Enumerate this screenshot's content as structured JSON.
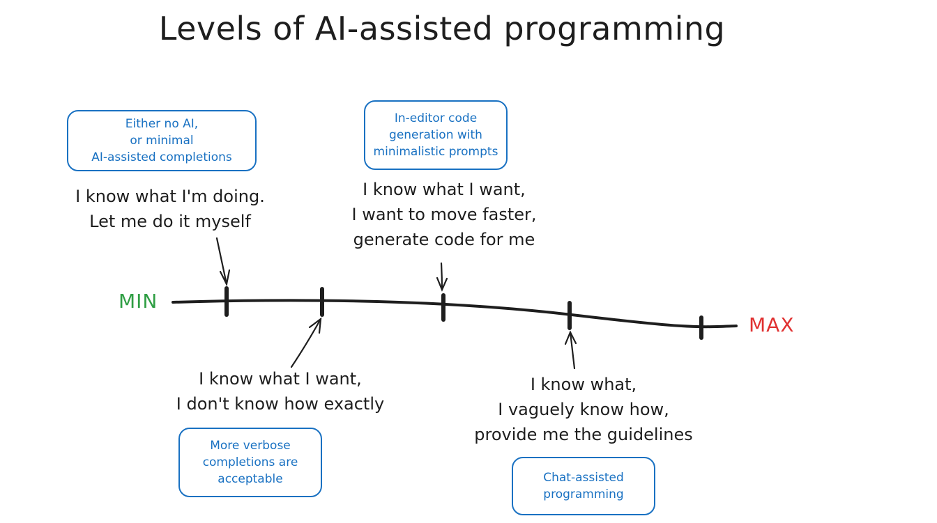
{
  "title": "Levels of AI-assisted programming",
  "scale": {
    "min_label": "MIN",
    "max_label": "MAX",
    "min_color": "#2f9e44",
    "max_color": "#e03131",
    "line_color": "#1e1e1e",
    "box_color": "#1971c2"
  },
  "levels": [
    {
      "caption": [
        "I know what I'm doing.",
        "Let me do it myself"
      ],
      "box": [
        "Either no AI,",
        "or minimal",
        "AI-assisted completions"
      ]
    },
    {
      "caption": [
        "I know what I want,",
        "I don't know how exactly"
      ],
      "box": [
        "More verbose",
        "completions are",
        "acceptable"
      ]
    },
    {
      "caption": [
        "I know what I want,",
        "I want to move faster,",
        "generate code for me"
      ],
      "box": [
        "In-editor code",
        "generation with",
        "minimalistic prompts"
      ]
    },
    {
      "caption": [
        "I know what,",
        "I vaguely know how,",
        "provide me the guidelines"
      ],
      "box": [
        "Chat-assisted",
        "programming"
      ]
    }
  ]
}
